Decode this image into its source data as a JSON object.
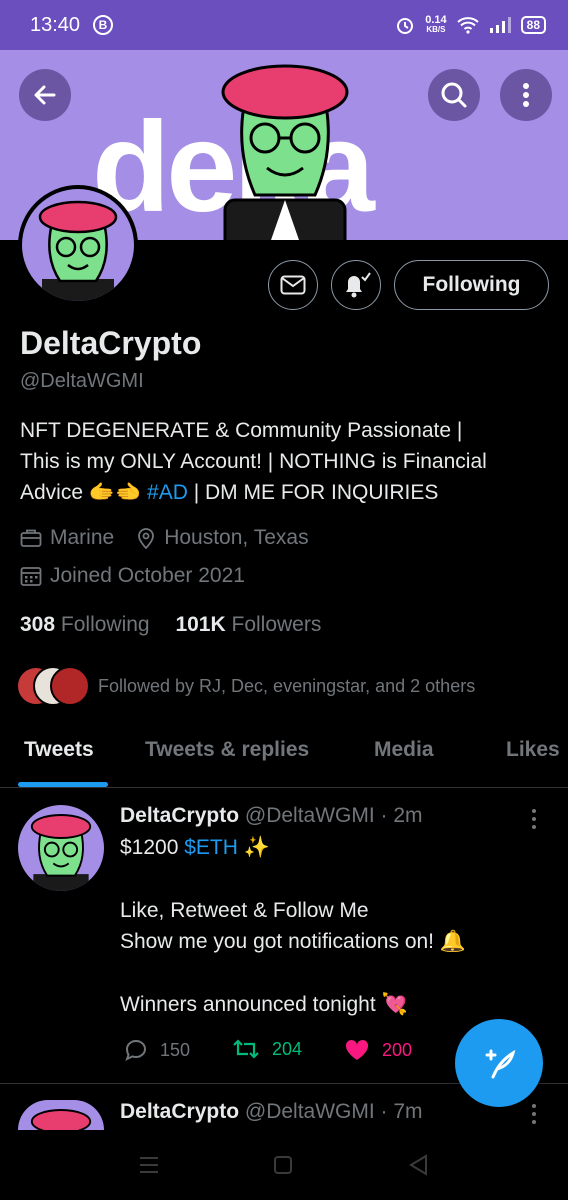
{
  "status_bar": {
    "time": "13:40",
    "b_badge": "B",
    "net_speed_value": "0.14",
    "net_speed_unit": "KB/S",
    "battery": "88"
  },
  "banner": {
    "word": "delta",
    "back_icon": "arrow-left-icon",
    "search_icon": "search-icon",
    "more_icon": "more-vertical-icon"
  },
  "profile": {
    "name": "DeltaCrypto",
    "handle": "@DeltaWGMI",
    "following_button": "Following",
    "bio_line1": "NFT DEGENERATE & Community Passionate |",
    "bio_line2": "This is my ONLY Account! | NOTHING is Financial",
    "bio_line3_pre": "Advice",
    "bio_emoji": "🫱‍🫲",
    "bio_hashtag": "#AD",
    "bio_line3_post": "| DM ME FOR INQUIRIES",
    "occupation": "Marine",
    "location": "Houston, Texas",
    "joined": "Joined October 2021",
    "following_count": "308",
    "following_label": "Following",
    "followers_count": "101K",
    "followers_label": "Followers",
    "followed_by": "Followed by RJ, Dec, eveningstar, and 2 others"
  },
  "tabs": [
    "Tweets",
    "Tweets & replies",
    "Media",
    "Likes"
  ],
  "tweets": [
    {
      "name": "DeltaCrypto",
      "handle": "@DeltaWGMI",
      "time": "· 2m",
      "line1_pre": "$1200",
      "line1_cashtag": "$ETH",
      "line1_emoji": "✨",
      "line2": "Like, Retweet & Follow Me",
      "line3": "Show me you got notifications on!",
      "line3_emoji": "🔔",
      "line4": "Winners announced tonight",
      "line4_emoji": "💘",
      "replies": "150",
      "retweets": "204",
      "likes": "200"
    },
    {
      "name": "DeltaCrypto",
      "handle": "@DeltaWGMI",
      "time": "· 7m"
    }
  ],
  "colors": {
    "accent": "#1d9bf0",
    "banner": "#a48ee6",
    "statusbar": "#6b4fbf",
    "retweet": "#00ba7c",
    "like": "#f91880"
  }
}
